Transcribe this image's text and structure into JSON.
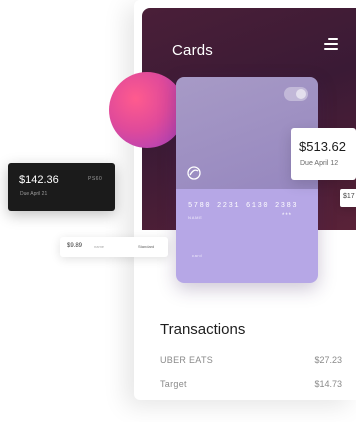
{
  "header": {
    "title": "Cards"
  },
  "card": {
    "number": "5780 2231 6130 2383",
    "holder": "NAME",
    "expiry": "***",
    "brand": "card"
  },
  "amount_card": {
    "amount": "$513.62",
    "due": "Due April 12"
  },
  "peek_card": {
    "text": "$17"
  },
  "dark_card": {
    "amount": "$142.36",
    "due": "Due April 21",
    "tag": "PS60"
  },
  "pill": {
    "amount": "$9.89",
    "middle": "name",
    "right": "Standard"
  },
  "transactions": {
    "title": "Transactions",
    "rows": [
      {
        "merchant": "UBER EATS",
        "amount": "$27.23"
      },
      {
        "merchant": "Target",
        "amount": "$14.73"
      }
    ]
  },
  "colors": {
    "header_bg": "#4a1f38",
    "card_top": "#a79ac6",
    "card_bottom": "#b6a7e6",
    "accent_circle": "#e04a9a"
  },
  "icons": {
    "menu": "hamburger-menu-icon",
    "card_logo": "swirl-logo-icon"
  }
}
